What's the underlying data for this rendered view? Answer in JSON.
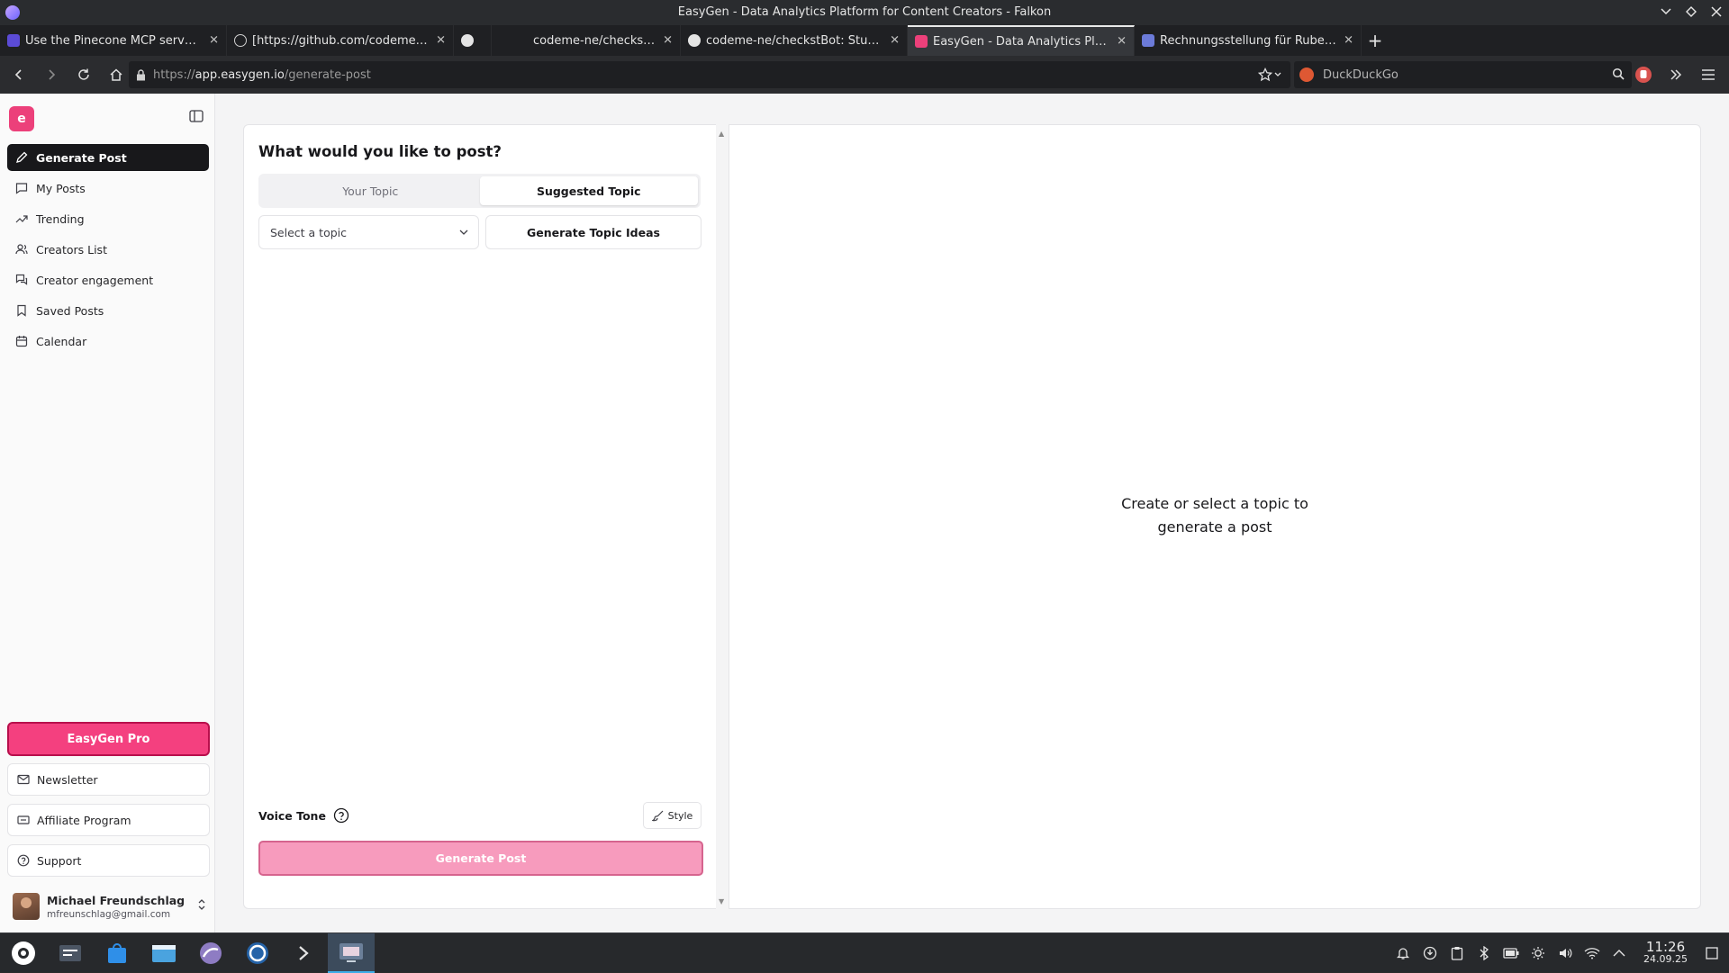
{
  "window": {
    "title": "EasyGen - Data Analytics Platform for Content Creators - Falkon"
  },
  "tabs": [
    {
      "label": "Use the Pinecone MCP server -...",
      "icon": "pinecone-icon",
      "color": "#5b4bd6"
    },
    {
      "label": "[https://github.com/codeme-n...",
      "icon": "github-mark-icon",
      "color": "#e4e4e4"
    },
    {
      "label": "",
      "icon": "github-icon",
      "color": "#e4e4e4"
    },
    {
      "label": "codeme-ne/checkstBot",
      "icon": "",
      "color": ""
    },
    {
      "label": "codeme-ne/checkstBot: Study ...",
      "icon": "github-icon",
      "color": "#e4e4e4"
    },
    {
      "label": "EasyGen - Data Analytics Platf...",
      "icon": "easygen-icon",
      "color": "#ec407a",
      "active": true
    },
    {
      "label": "Rechnungsstellung für Ruben ...",
      "icon": "document-icon",
      "color": "#6c7bd9"
    }
  ],
  "navbar": {
    "url_prefix": "https://",
    "url_host": "app.easygen.io",
    "url_path": "/generate-post",
    "search_placeholder": "DuckDuckGo"
  },
  "sidebar": {
    "logo": "e",
    "items": [
      {
        "label": "Generate Post",
        "icon": "pencil-icon",
        "active": true
      },
      {
        "label": "My Posts",
        "icon": "message-icon"
      },
      {
        "label": "Trending",
        "icon": "trending-icon"
      },
      {
        "label": "Creators List",
        "icon": "users-icon"
      },
      {
        "label": "Creator engagement",
        "icon": "engagement-icon"
      },
      {
        "label": "Saved Posts",
        "icon": "bookmark-icon"
      },
      {
        "label": "Calendar",
        "icon": "calendar-icon"
      }
    ],
    "pro_label": "EasyGen Pro",
    "newsletter": "Newsletter",
    "affiliate": "Affiliate Program",
    "support": "Support",
    "user": {
      "name": "Michael Freundschlag",
      "email": "mfreunschlag@gmail.com"
    }
  },
  "composer": {
    "heading": "What would you like to post?",
    "tab_your_topic": "Your Topic",
    "tab_suggested": "Suggested Topic",
    "select_placeholder": "Select a topic",
    "generate_ideas": "Generate Topic Ideas",
    "voice_tone": "Voice Tone",
    "style_button": "Style",
    "generate_post": "Generate Post"
  },
  "preview": {
    "empty_line1": "Create or select a topic to",
    "empty_line2": "generate a post"
  },
  "taskbar": {
    "time": "11:26",
    "date": "24.09.25"
  },
  "colors": {
    "brand": "#ec407a",
    "pro_button": "#f4407f",
    "generate_disabled": "#f79bbd"
  }
}
